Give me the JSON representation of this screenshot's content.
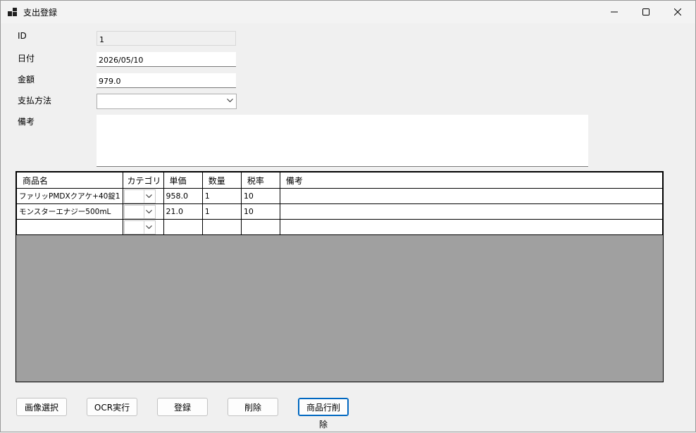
{
  "window": {
    "title": "支出登録"
  },
  "form": {
    "id_label": "ID",
    "id_value": "1",
    "date_label": "日付",
    "date_value": "2026/05/10",
    "amount_label": "金額",
    "amount_value": "979.0",
    "payment_label": "支払方法",
    "payment_value": "",
    "memo_label": "備考",
    "memo_value": ""
  },
  "grid": {
    "columns": [
      "商品名",
      "カテゴリ",
      "単価",
      "数量",
      "税率",
      "備考"
    ],
    "rows": [
      {
        "name": "ファリッPMDXクアケ+40錠1",
        "category": "",
        "price": "958.0",
        "qty": "1",
        "tax": "10",
        "memo": ""
      },
      {
        "name": "モンスターエナジー500mL",
        "category": "",
        "price": "21.0",
        "qty": "1",
        "tax": "10",
        "memo": ""
      },
      {
        "name": "",
        "category": "",
        "price": "",
        "qty": "",
        "tax": "",
        "memo": ""
      }
    ]
  },
  "buttons": {
    "select_image": "画像選択",
    "run_ocr": "OCR実行",
    "register": "登録",
    "delete": "削除",
    "delete_item_row": "商品行削除"
  },
  "icons": {
    "app": "app-icon",
    "minimize": "minimize-icon",
    "maximize": "maximize-icon",
    "close": "close-icon",
    "dropdown": "chevron-down-icon"
  }
}
